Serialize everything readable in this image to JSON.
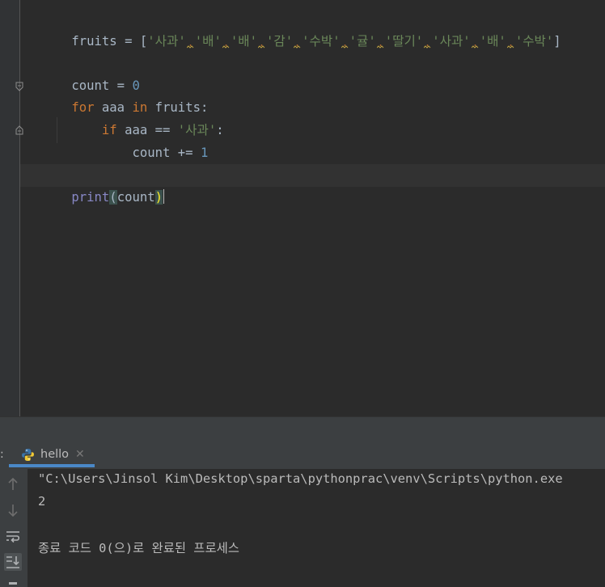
{
  "editor": {
    "lines": {
      "l1": {
        "var": "fruits",
        "op": " = [",
        "items": [
          "'사과'",
          "'배'",
          "'배'",
          "'감'",
          "'수박'",
          "'귤'",
          "'딸기'",
          "'사과'",
          "'배'",
          "'수박'"
        ],
        "close": "]"
      },
      "l3": {
        "var": "count",
        "op": " = ",
        "num": "0"
      },
      "l4": {
        "kw_for": "for",
        "var": " aaa ",
        "kw_in": "in",
        "rest": " fruits:"
      },
      "l5": {
        "indent": "    ",
        "kw_if": "if",
        "rest": " aaa == ",
        "str": "'사과'",
        "colon": ":"
      },
      "l6": {
        "indent": "        ",
        "rest": "count += ",
        "num": "1"
      },
      "l8": {
        "fn": "print",
        "open": "(",
        "arg": "count",
        "close": ")"
      }
    }
  },
  "run_panel": {
    "label": ":",
    "tab": {
      "label": "hello",
      "close": "✕",
      "icon": "python-icon"
    },
    "toolbar": [
      "up-arrow-icon",
      "down-arrow-icon",
      "soft-wrap-icon",
      "scroll-to-end-icon"
    ],
    "console": {
      "command": "\"C:\\Users\\Jinsol Kim\\Desktop\\sparta\\pythonprac\\venv\\Scripts\\python.exe",
      "output": "2",
      "exit_message": "종료 코드 0(으)로 완료된 프로세스"
    }
  },
  "colors": {
    "editor_bg": "#2b2b2b",
    "keyword": "#cc7832",
    "string": "#6a8759",
    "number": "#6897bb",
    "builtin": "#8888c6",
    "text": "#a9b7c6",
    "accent": "#4a88c7"
  }
}
